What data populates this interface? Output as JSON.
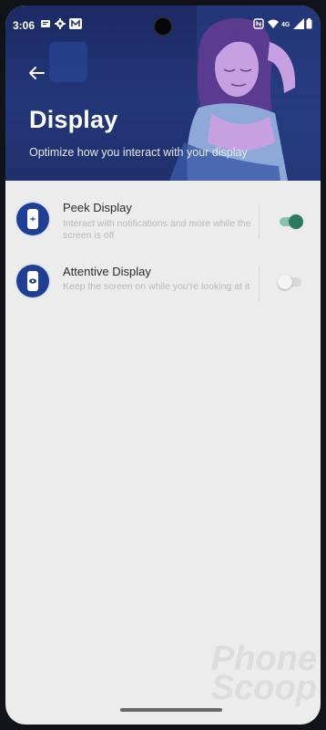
{
  "status_bar": {
    "time": "3:06",
    "left_icons": [
      "message-icon",
      "gear-icon",
      "m-badge-icon"
    ],
    "right_icons": [
      "nfc-icon",
      "wifi-icon",
      "lte-icon",
      "signal-icon",
      "battery-icon"
    ]
  },
  "header": {
    "title": "Display",
    "subtitle": "Optimize how you interact with your display"
  },
  "settings": [
    {
      "title": "Peek Display",
      "description": "Interact with notifications and more while the screen is off",
      "enabled": true
    },
    {
      "title": "Attentive Display",
      "description": "Keep the screen on while you're looking at it",
      "enabled": false
    }
  ],
  "watermark": {
    "line1": "Phone",
    "line2": "Scoop"
  },
  "colors": {
    "hero_bg": "#233678",
    "icon_ring": "#1e3f93",
    "toggle_on": "#2a7b5e"
  }
}
